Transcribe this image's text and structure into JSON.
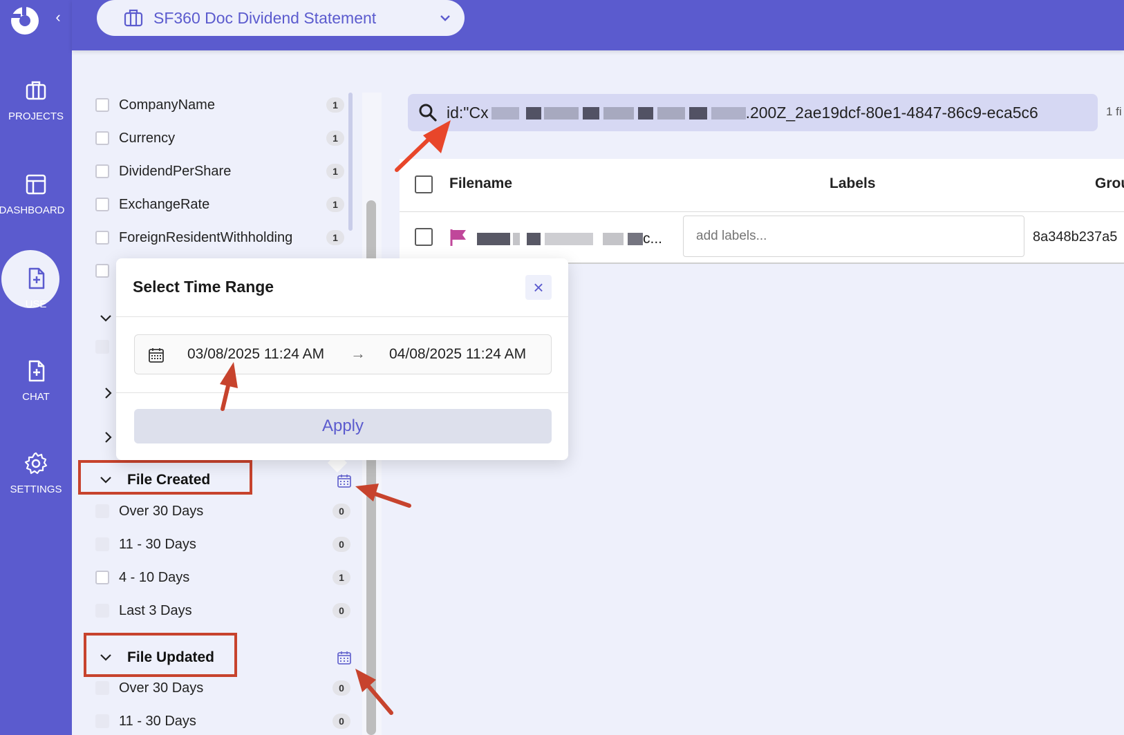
{
  "sidebar": {
    "items": [
      {
        "label": "PROJECTS",
        "icon": "briefcase-icon"
      },
      {
        "label": "DASHBOARD",
        "icon": "layout-icon"
      },
      {
        "label": "USE",
        "icon": "file-plus-icon"
      },
      {
        "label": "CHAT",
        "icon": "file-plus-icon"
      },
      {
        "label": "SETTINGS",
        "icon": "gear-icon"
      }
    ],
    "active": "USE"
  },
  "header": {
    "project_name": "SF360 Doc Dividend Statement"
  },
  "filters": {
    "fields": [
      {
        "label": "CompanyName",
        "count": "1"
      },
      {
        "label": "Currency",
        "count": "1"
      },
      {
        "label": "DividendPerShare",
        "count": "1"
      },
      {
        "label": "ExchangeRate",
        "count": "1"
      },
      {
        "label": "ForeignResidentWithholding",
        "count": "1"
      }
    ],
    "file_created": {
      "title": "File Created",
      "options": [
        {
          "label": "Over 30 Days",
          "count": "0"
        },
        {
          "label": "11 - 30 Days",
          "count": "0"
        },
        {
          "label": "4 - 10 Days",
          "count": "1"
        },
        {
          "label": "Last 3 Days",
          "count": "0"
        }
      ]
    },
    "file_updated": {
      "title": "File Updated",
      "options": [
        {
          "label": "Over 30 Days",
          "count": "0"
        },
        {
          "label": "11 - 30 Days",
          "count": "0"
        }
      ]
    }
  },
  "search": {
    "query_prefix": "id:\"Cx",
    "query_suffix": ".200Z_2ae19dcf-80e1-4847-86c9-eca5c6",
    "result_count": "1 fi"
  },
  "table": {
    "columns": [
      "Filename",
      "Labels",
      "Grou"
    ],
    "rows": [
      {
        "filename_suffix": "c...",
        "labels_placeholder": "add labels...",
        "group": "8a348b237a5"
      }
    ]
  },
  "popover": {
    "title": "Select Time Range",
    "start": "03/08/2025 11:24 AM",
    "end": "04/08/2025 11:24 AM",
    "arrow": "→",
    "apply_label": "Apply",
    "close": "×"
  },
  "colors": {
    "brand": "#5b5bce",
    "annotation": "#c7432d",
    "flag": "#c0479a"
  }
}
